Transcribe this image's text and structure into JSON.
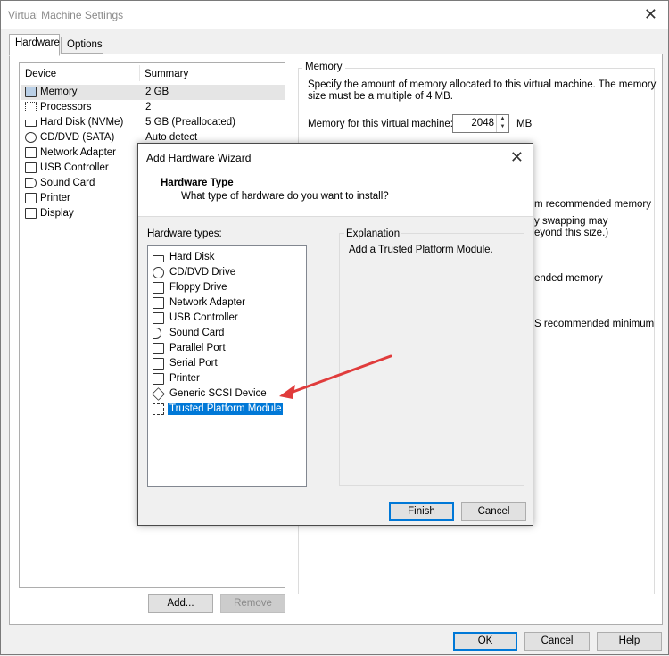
{
  "window": {
    "title": "Virtual Machine Settings",
    "close": "✕"
  },
  "tabs": [
    {
      "label": "Hardware"
    },
    {
      "label": "Options"
    }
  ],
  "device_list": {
    "headers": {
      "device": "Device",
      "summary": "Summary"
    },
    "rows": [
      {
        "name": "Memory",
        "summary": "2 GB",
        "icon": "memory-icon"
      },
      {
        "name": "Processors",
        "summary": "2",
        "icon": "processor-icon"
      },
      {
        "name": "Hard Disk (NVMe)",
        "summary": "5 GB (Preallocated)",
        "icon": "hard-disk-icon"
      },
      {
        "name": "CD/DVD (SATA)",
        "summary": "Auto detect",
        "icon": "cd-dvd-icon"
      },
      {
        "name": "Network Adapter",
        "summary": "",
        "icon": "network-adapter-icon"
      },
      {
        "name": "USB Controller",
        "summary": "",
        "icon": "usb-icon"
      },
      {
        "name": "Sound Card",
        "summary": "",
        "icon": "sound-icon"
      },
      {
        "name": "Printer",
        "summary": "",
        "icon": "printer-icon"
      },
      {
        "name": "Display",
        "summary": "",
        "icon": "display-icon"
      }
    ]
  },
  "device_buttons": {
    "add": "Add...",
    "remove": "Remove"
  },
  "memory": {
    "group_label": "Memory",
    "description_line1": "Specify the amount of memory allocated to this virtual machine. The memory",
    "description_line2": "size must be a multiple of 4 MB.",
    "field_label": "Memory for this virtual machine:",
    "value": "2048",
    "unit": "MB",
    "partial_text": {
      "line1": "m recommended memory",
      "line2": "y swapping may",
      "line3": "eyond this size.)",
      "line4": "ended memory",
      "line5": "S recommended minimum"
    }
  },
  "main_buttons": {
    "ok": "OK",
    "cancel": "Cancel",
    "help": "Help"
  },
  "wizard": {
    "title": "Add Hardware Wizard",
    "header_title": "Hardware Type",
    "header_subtitle": "What type of hardware do you want to install?",
    "types_label": "Hardware types:",
    "types": [
      {
        "label": "Hard Disk",
        "icon": "hard-disk-icon"
      },
      {
        "label": "CD/DVD Drive",
        "icon": "cd-dvd-icon"
      },
      {
        "label": "Floppy Drive",
        "icon": "floppy-icon"
      },
      {
        "label": "Network Adapter",
        "icon": "network-adapter-icon"
      },
      {
        "label": "USB Controller",
        "icon": "usb-icon"
      },
      {
        "label": "Sound Card",
        "icon": "sound-icon"
      },
      {
        "label": "Parallel Port",
        "icon": "parallel-port-icon"
      },
      {
        "label": "Serial Port",
        "icon": "serial-port-icon"
      },
      {
        "label": "Printer",
        "icon": "printer-icon"
      },
      {
        "label": "Generic SCSI Device",
        "icon": "scsi-icon"
      },
      {
        "label": "Trusted Platform Module",
        "icon": "tpm-icon"
      }
    ],
    "selected": "Trusted Platform Module",
    "explanation_label": "Explanation",
    "explanation_text": "Add a Trusted Platform Module.",
    "finish": "Finish",
    "cancel": "Cancel"
  },
  "annotation": {
    "color": "#e03c3c"
  },
  "colors": {
    "accent": "#0078d7"
  }
}
